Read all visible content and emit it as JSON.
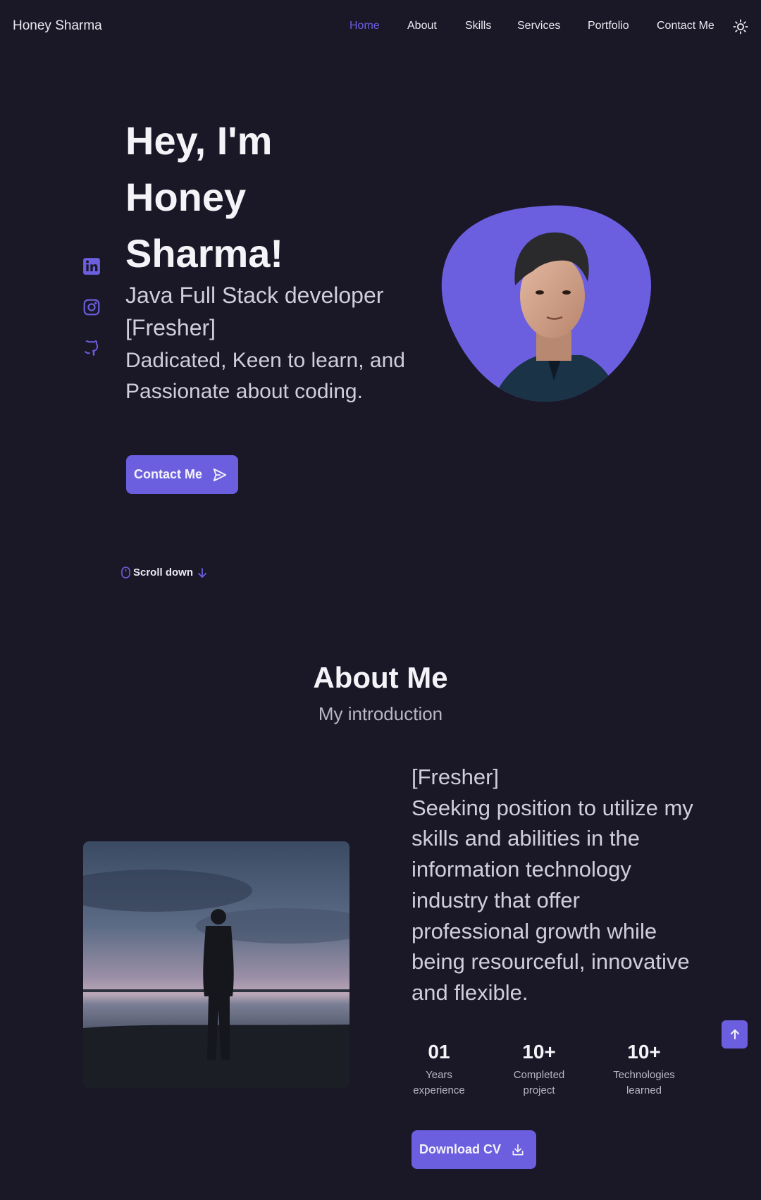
{
  "header": {
    "logo": "Honey Sharma",
    "nav": [
      "Home",
      "About",
      "Skills",
      "Services",
      "Portfolio",
      "Contact Me"
    ]
  },
  "hero": {
    "title_lines": [
      "Hey, I'm",
      "Honey",
      "Sharma!"
    ],
    "subtitle": "Java Full Stack developer [Fresher]",
    "description": "Dadicated, Keen to learn, and Passionate about coding.",
    "contact_button": "Contact Me",
    "scroll_down": "Scroll down"
  },
  "about": {
    "title": "About Me",
    "subtitle": "My introduction",
    "description": "[Fresher]\nSeeking position to utilize my skills and abilities in the information technology industry that offer professional growth while being resourceful, innovative and flexible.",
    "stats": [
      {
        "number": "01",
        "label": "Years experience"
      },
      {
        "number": "10+",
        "label": "Completed project"
      },
      {
        "number": "10+",
        "label": "Technologies learned"
      }
    ],
    "download_button": "Download CV"
  },
  "colors": {
    "background": "#1a1726",
    "accent": "#6b5fe0",
    "text": "#f4f3f8",
    "muted": "#b8b7c7"
  },
  "icons": {
    "social": [
      "linkedin-icon",
      "instagram-icon",
      "github-icon"
    ],
    "theme": "sun-icon",
    "send": "send-icon",
    "mouse": "mouse-icon",
    "arrow_down": "arrow-down-icon",
    "download": "download-icon",
    "arrow_up": "arrow-up-icon"
  }
}
